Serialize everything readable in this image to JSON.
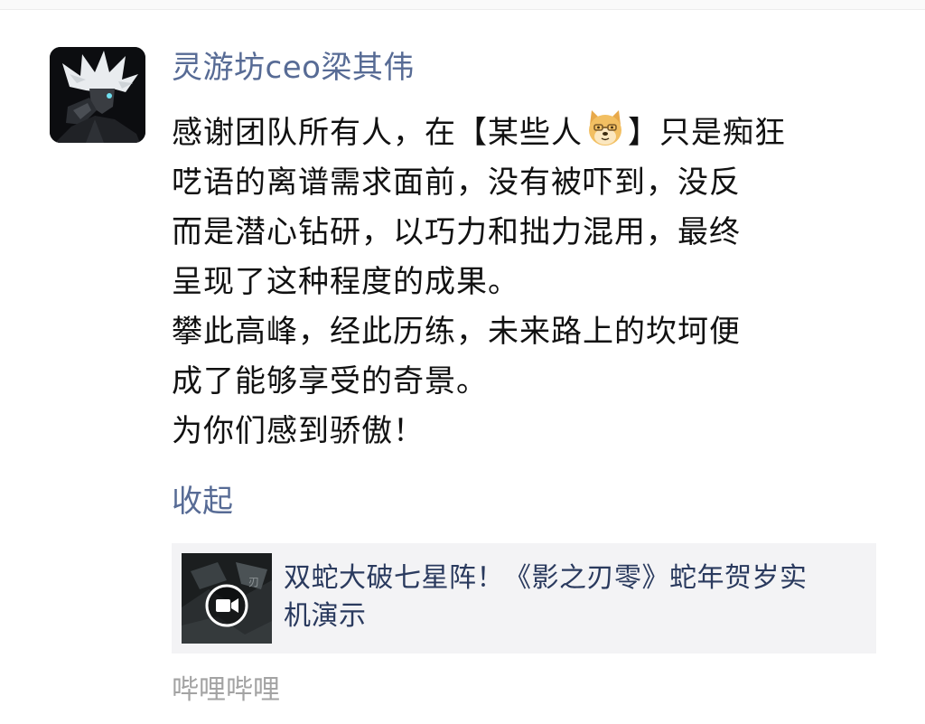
{
  "moment": {
    "author": "灵游坊ceo梁其伟",
    "text_lines": [
      [
        "感谢团队所有人，在【某些人",
        "】只是痴狂"
      ],
      "呓语的离谱需求面前，没有被吓到，没反",
      "而是潜心钻研，以巧力和拙力混用，最终",
      "呈现了这种程度的成果。",
      "攀此高峰，经此历练，未来路上的坎坷便",
      "成了能够享受的奇景。",
      "为你们感到骄傲！"
    ],
    "inline_emoji": "doge-emoji",
    "collapse_label": "收起"
  },
  "shared_link": {
    "title_lines": [
      "双蛇大破七星阵！《影之刃零》蛇年贺岁实",
      "机演示"
    ],
    "thumbnail_icon": "video-camera-icon"
  },
  "source_label": "哔哩哔哩",
  "colors": {
    "link_blue": "#576b95",
    "text": "#111111",
    "card_bg": "#f3f3f5",
    "source_gray": "#a3a3a3"
  }
}
